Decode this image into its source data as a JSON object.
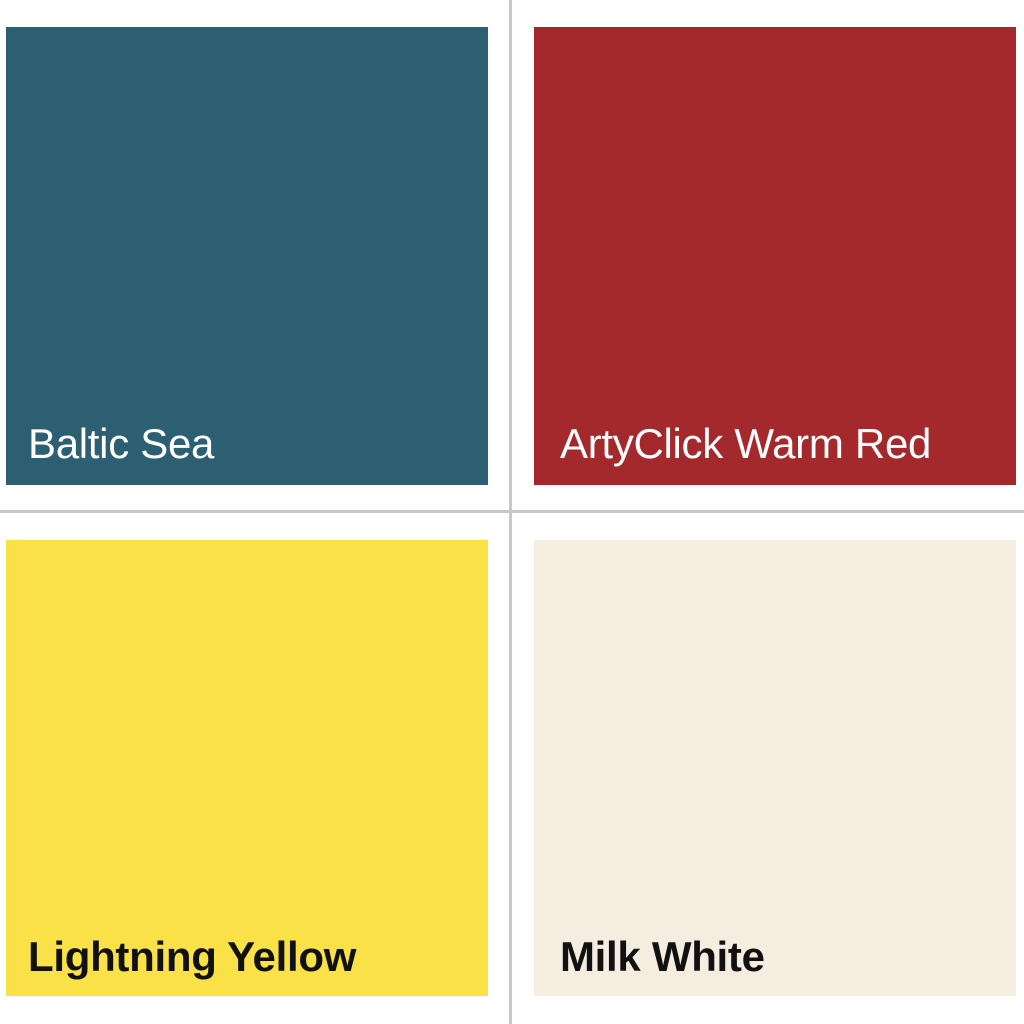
{
  "swatches": [
    {
      "name": "Baltic Sea",
      "color": "#2d5f72",
      "text_color": "#ffffff"
    },
    {
      "name": "ArtyClick Warm Red",
      "color": "#a4292d",
      "text_color": "#ffffff"
    },
    {
      "name": "Lightning Yellow",
      "color": "#fae148",
      "text_color": "#111111"
    },
    {
      "name": "Milk White",
      "color": "#f4ede0",
      "text_color": "#111111"
    }
  ]
}
